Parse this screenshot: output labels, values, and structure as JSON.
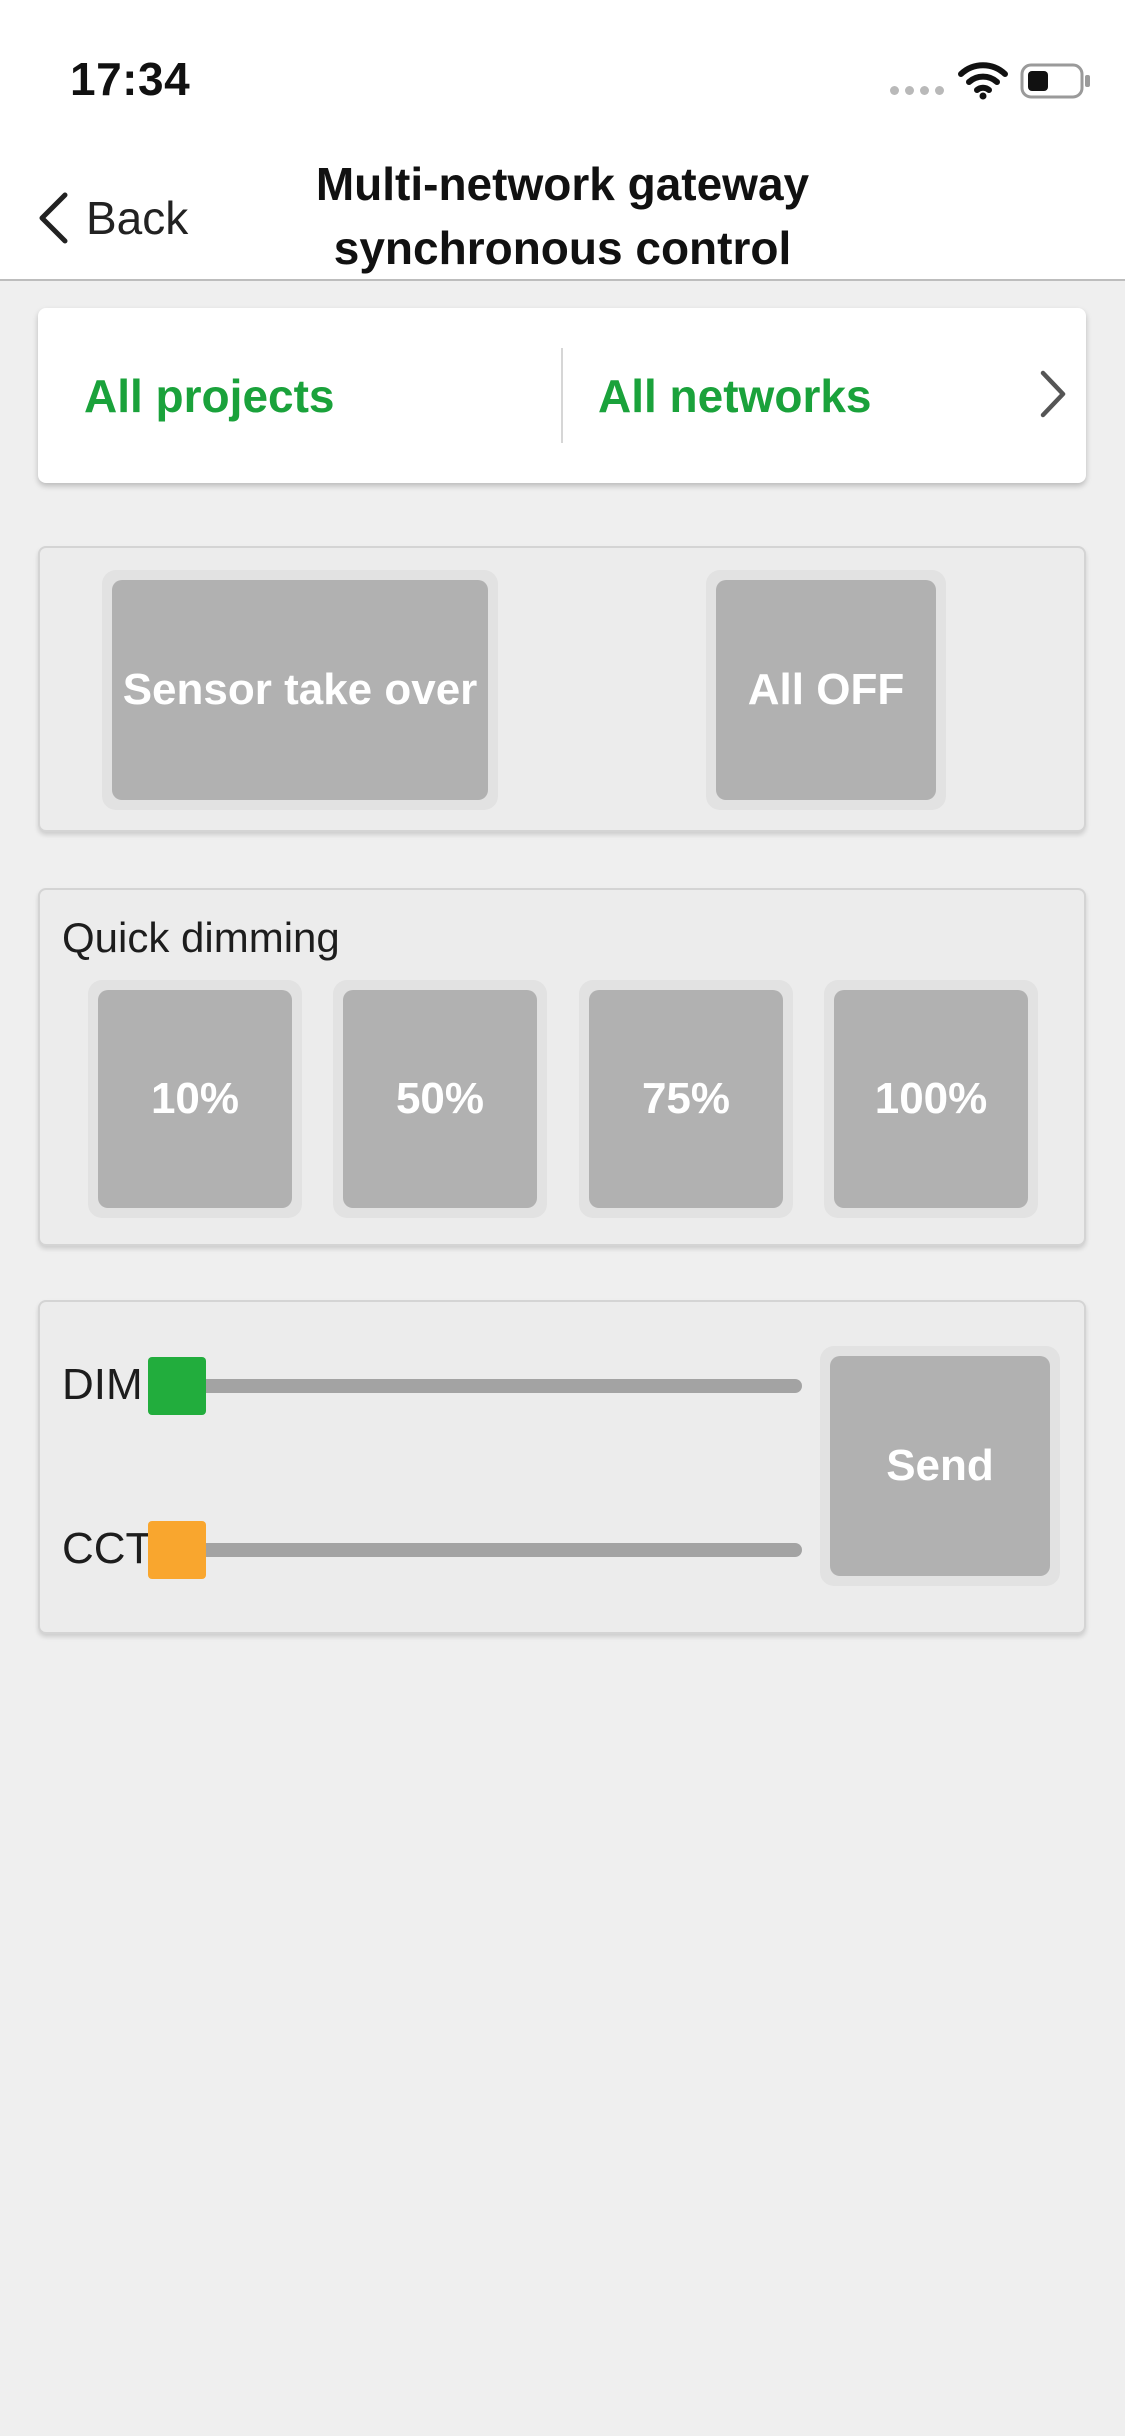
{
  "status_bar": {
    "time": "17:34"
  },
  "nav": {
    "back_label": "Back",
    "title_line1": "Multi-network gateway",
    "title_line2": "synchronous control"
  },
  "selector": {
    "projects_label": "All projects",
    "networks_label": "All networks"
  },
  "actions": {
    "sensor_takeover_label": "Sensor take over",
    "all_off_label": "All OFF"
  },
  "quick_dimming": {
    "label": "Quick dimming",
    "options": [
      "10%",
      "50%",
      "75%",
      "100%"
    ]
  },
  "controls": {
    "dim_label": "DIM",
    "cct_label": "CCT",
    "dim_value_fraction": 0,
    "cct_value_fraction": 0,
    "send_label": "Send"
  },
  "colors": {
    "accent_green": "#1aa23b",
    "dim_thumb": "#22ad3d",
    "cct_thumb": "#f9a62e",
    "button_gray": "#b1b1b1"
  },
  "icons": {
    "back": "chevron-left-icon",
    "selector_forward": "chevron-right-icon",
    "wifi": "wifi-icon",
    "battery": "battery-icon"
  }
}
